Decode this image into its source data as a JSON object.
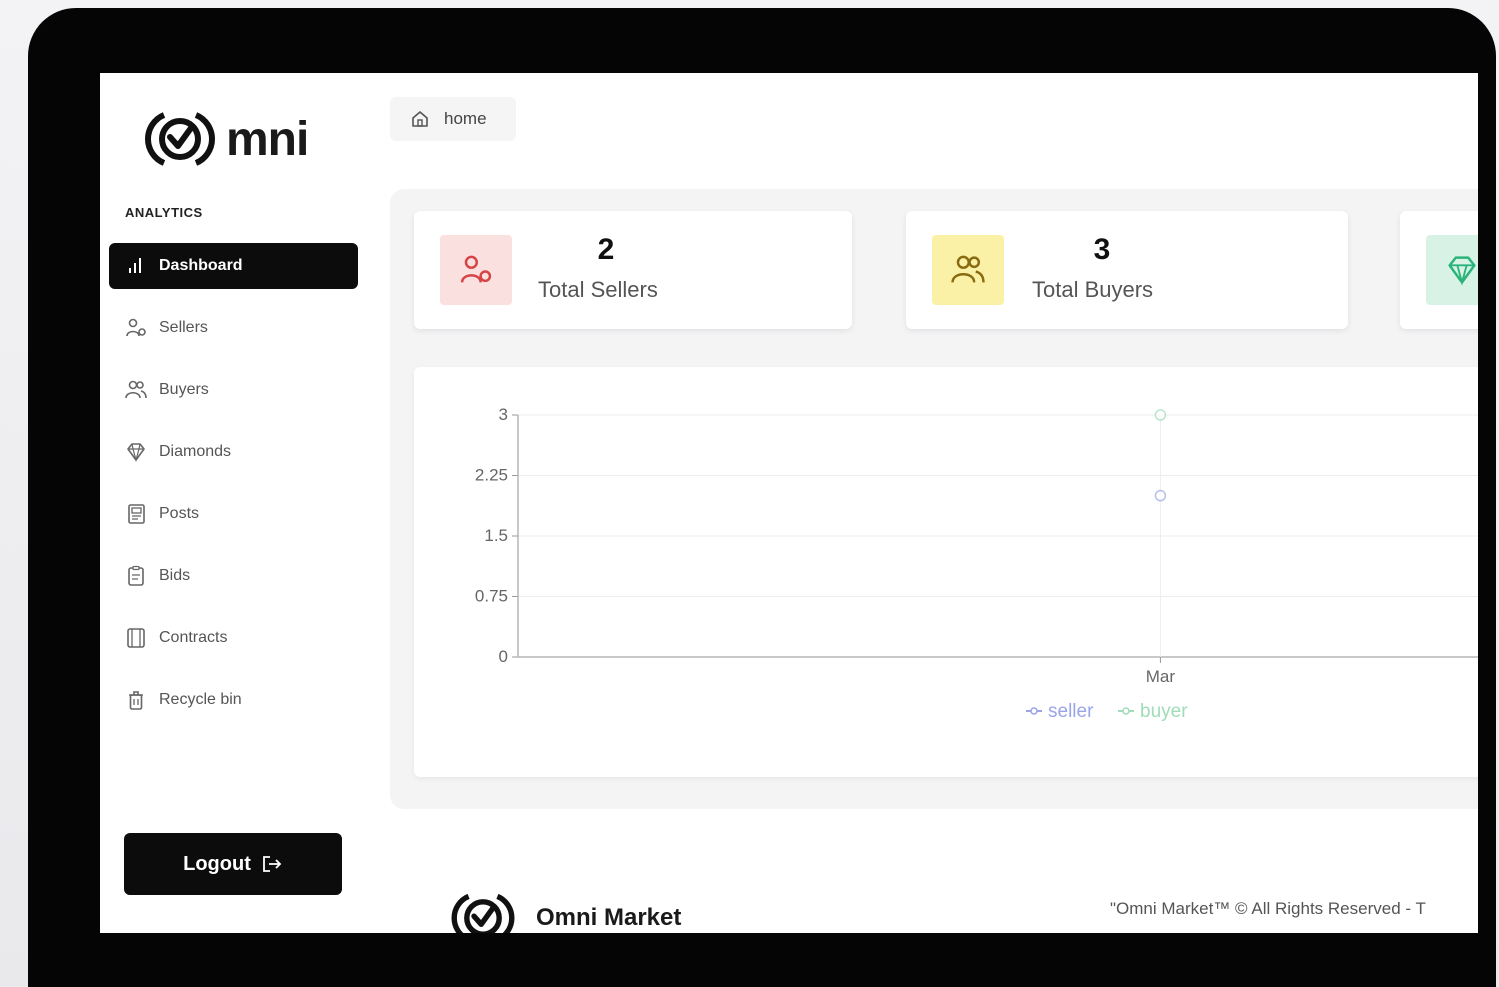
{
  "sidebar": {
    "logo_text": "mni",
    "section_label": "ANALYTICS",
    "items": [
      {
        "label": "Dashboard",
        "icon": "bar-chart-icon"
      },
      {
        "label": "Sellers",
        "icon": "seller-icon"
      },
      {
        "label": "Buyers",
        "icon": "buyers-icon"
      },
      {
        "label": "Diamonds",
        "icon": "diamond-icon"
      },
      {
        "label": "Posts",
        "icon": "posts-icon"
      },
      {
        "label": "Bids",
        "icon": "bids-icon"
      },
      {
        "label": "Contracts",
        "icon": "contracts-icon"
      },
      {
        "label": "Recycle bin",
        "icon": "trash-icon"
      }
    ],
    "logout_label": "Logout"
  },
  "breadcrumb": {
    "label": "home"
  },
  "stats": [
    {
      "value": "2",
      "label": "Total Sellers",
      "icon": "seller-icon",
      "bg": "#fbe0e0",
      "color": "#d64545"
    },
    {
      "value": "3",
      "label": "Total Buyers",
      "icon": "buyers-icon",
      "bg": "#faf1a6",
      "color": "#8a6a10"
    },
    {
      "icon": "diamond-icon",
      "bg": "#d8f3e6",
      "color": "#2bb37a"
    }
  ],
  "chart_data": {
    "type": "line",
    "categories": [
      "Mar"
    ],
    "series": [
      {
        "name": "seller",
        "values": [
          2
        ],
        "color": "#9aa4e8"
      },
      {
        "name": "buyer",
        "values": [
          3
        ],
        "color": "#9fdcb7"
      }
    ],
    "yticks": [
      "0",
      "0.75",
      "1.5",
      "2.25",
      "3"
    ],
    "ylim": [
      0,
      3
    ],
    "grid": true,
    "legend": "bottom"
  },
  "footer": {
    "name": "Omni Market",
    "copyright": "\"Omni Market™ © All Rights Reserved - T"
  }
}
